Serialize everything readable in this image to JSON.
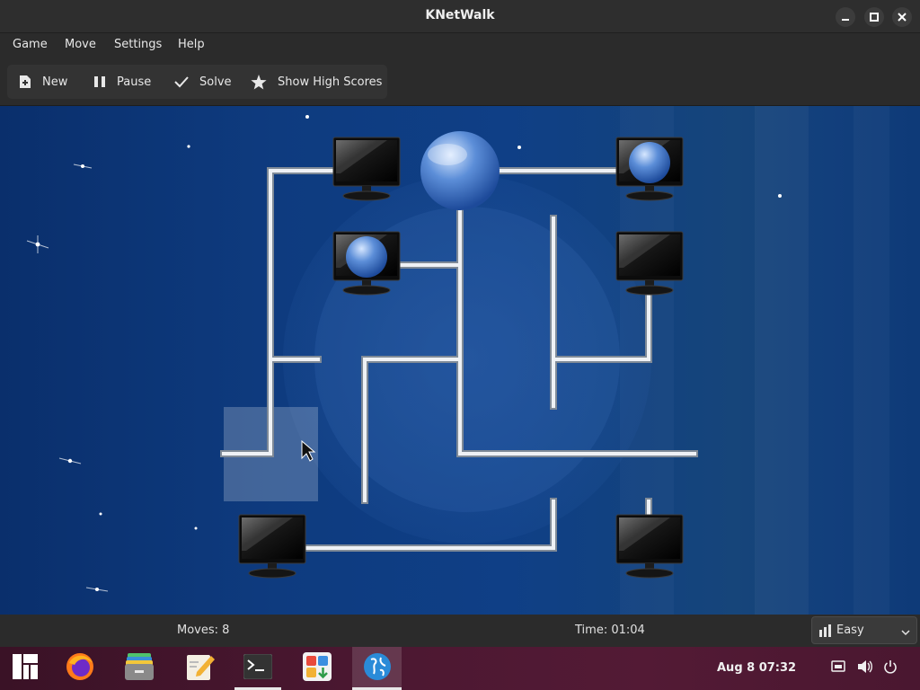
{
  "window": {
    "title": "KNetWalk"
  },
  "menu": {
    "items": [
      "Game",
      "Move",
      "Settings",
      "Help"
    ]
  },
  "toolbar": {
    "new_label": "New",
    "pause_label": "Pause",
    "solve_label": "Solve",
    "highscores_label": "Show High Scores"
  },
  "status": {
    "moves": "Moves: 8",
    "time": "Time: 01:04"
  },
  "difficulty": {
    "selected": "Easy"
  },
  "taskbar": {
    "apps": [
      "start-menu",
      "firefox",
      "file-manager",
      "text-editor",
      "terminal",
      "software-center",
      "knetwalk"
    ],
    "active_app": "knetwalk",
    "clock": "Aug 8  07:32"
  },
  "colors": {
    "board_bg": "#0e3b7f",
    "highlight": "#ffffff",
    "cable": "#d8dde3",
    "taskbar": "#4d1832"
  }
}
